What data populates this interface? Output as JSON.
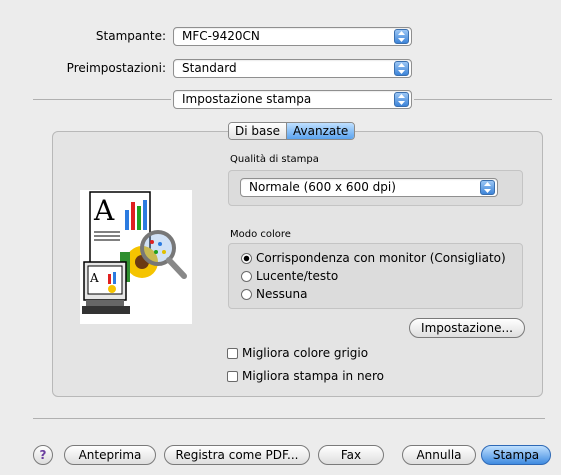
{
  "printer": {
    "label": "Stampante:",
    "value": "MFC-9420CN"
  },
  "presets": {
    "label": "Preimpostazioni:",
    "value": "Standard"
  },
  "panel": {
    "value": "Impostazione stampa"
  },
  "tabs": [
    {
      "label": "Di base",
      "active": false
    },
    {
      "label": "Avanzate",
      "active": true
    }
  ],
  "quality": {
    "label": "Qualità di stampa",
    "value": "Normale (600 x 600 dpi)"
  },
  "color_mode": {
    "label": "Modo colore",
    "options": [
      {
        "label": "Corrispondenza con monitor (Consigliato)",
        "selected": true
      },
      {
        "label": "Lucente/testo",
        "selected": false
      },
      {
        "label": "Nessuna",
        "selected": false
      }
    ],
    "settings_button": "Impostazione..."
  },
  "checkboxes": [
    {
      "label": "Migliora colore grigio",
      "checked": false
    },
    {
      "label": "Migliora stampa in nero",
      "checked": false
    }
  ],
  "footer": {
    "help": "?",
    "preview": "Anteprima",
    "save_pdf": "Registra come PDF...",
    "fax": "Fax",
    "cancel": "Annulla",
    "print": "Stampa"
  },
  "colors": {
    "accent": "#3f8be0",
    "window_bg": "#ececec"
  }
}
